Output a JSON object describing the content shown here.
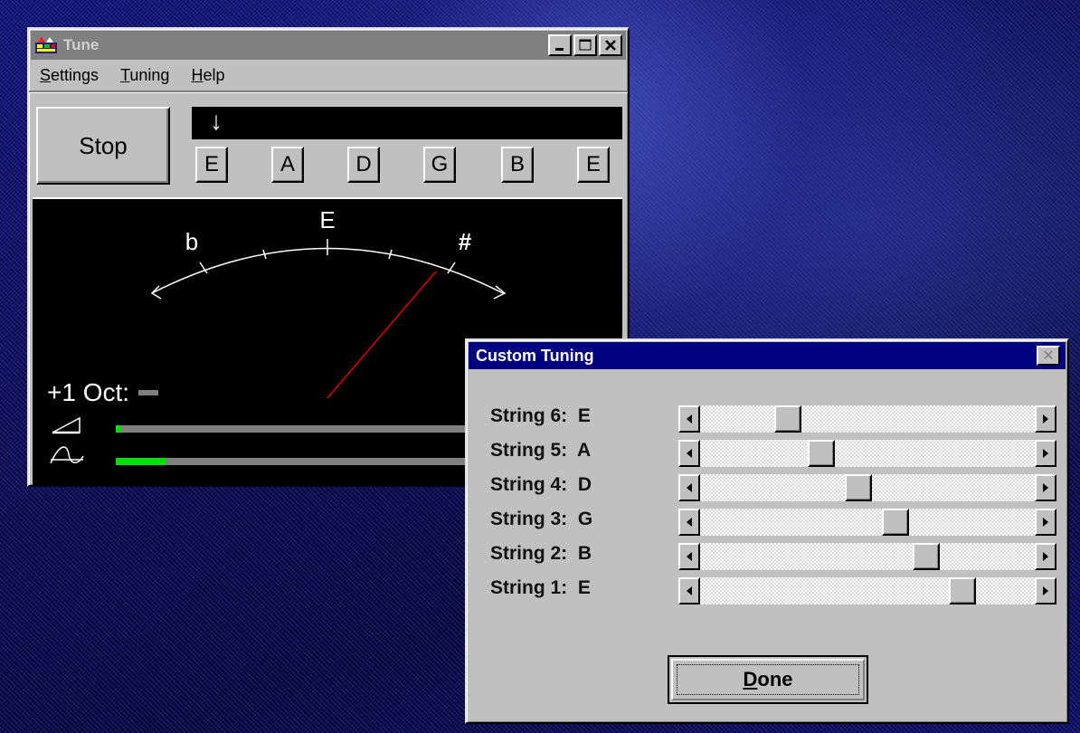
{
  "tune": {
    "title": "Tune",
    "menu": [
      {
        "u": "S",
        "rest": "ettings"
      },
      {
        "u": "T",
        "rest": "uning"
      },
      {
        "u": "H",
        "rest": "elp"
      }
    ],
    "stop_label": "Stop",
    "strip_arrow": "↓",
    "notes": [
      "E",
      "A",
      "D",
      "G",
      "B",
      "E"
    ],
    "meter": {
      "flat": "b",
      "note": "E",
      "sharp": "#",
      "needle_color": "#e00000"
    },
    "octave_label": "+1 Oct:",
    "volume_level": 0.01,
    "signal_level": 0.1
  },
  "custom": {
    "title": "Custom Tuning",
    "close_glyph": "✕",
    "strings": [
      {
        "label": "String 6:  E",
        "value": 0.24
      },
      {
        "label": "String 5:  A",
        "value": 0.35
      },
      {
        "label": "String 4:  D",
        "value": 0.47
      },
      {
        "label": "String 3:  G",
        "value": 0.59
      },
      {
        "label": "String 2:  B",
        "value": 0.69
      },
      {
        "label": "String 1:  E",
        "value": 0.81
      }
    ],
    "done": {
      "u": "D",
      "rest": "one"
    }
  },
  "colors": {
    "active_title": "#000080",
    "inactive_title": "#808080",
    "meter_green": "#00e000"
  }
}
